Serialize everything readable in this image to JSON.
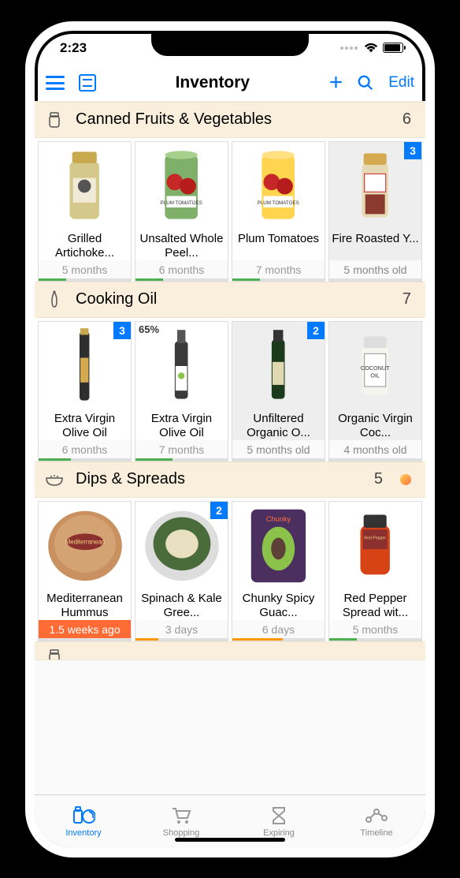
{
  "status": {
    "time": "2:23"
  },
  "nav": {
    "title": "Inventory",
    "edit": "Edit"
  },
  "sections": [
    {
      "icon": "jar",
      "title": "Canned Fruits & Vegetables",
      "count": "6",
      "dot": false,
      "items": [
        {
          "name": "Grilled Artichoke...",
          "age": "5 months",
          "badge": null,
          "pct": null,
          "aged": false,
          "progress": 30,
          "pcolor": "green",
          "img": "artichoke-jar"
        },
        {
          "name": "Unsalted Whole Peel...",
          "age": "6 months",
          "badge": null,
          "pct": null,
          "aged": false,
          "progress": 30,
          "pcolor": "green",
          "img": "plum-can-green"
        },
        {
          "name": "Plum Tomatoes",
          "age": "7 months",
          "badge": null,
          "pct": null,
          "aged": false,
          "progress": 30,
          "pcolor": "green",
          "img": "plum-can-yellow"
        },
        {
          "name": "Fire Roasted Y...",
          "age": "5 months old",
          "badge": "3",
          "pct": null,
          "aged": true,
          "progress": 0,
          "pcolor": "green",
          "img": "pepper-jar"
        }
      ]
    },
    {
      "icon": "oil",
      "title": "Cooking Oil",
      "count": "7",
      "dot": false,
      "items": [
        {
          "name": "Extra Virgin Olive Oil",
          "age": "6 months",
          "badge": "3",
          "pct": null,
          "aged": false,
          "progress": 35,
          "pcolor": "green",
          "img": "olive-tall-dark"
        },
        {
          "name": "Extra Virgin Olive Oil",
          "age": "7 months",
          "badge": null,
          "pct": "65%",
          "aged": false,
          "progress": 40,
          "pcolor": "green",
          "img": "olive-bottle-label"
        },
        {
          "name": "Unfiltered Organic O...",
          "age": "5 months old",
          "badge": "2",
          "pct": null,
          "aged": true,
          "progress": 0,
          "pcolor": "green",
          "img": "olive-dark-green"
        },
        {
          "name": "Organic Virgin Coc...",
          "age": "4 months old",
          "badge": null,
          "pct": null,
          "aged": true,
          "progress": 0,
          "pcolor": "green",
          "img": "coconut-jar"
        }
      ]
    },
    {
      "icon": "bowl",
      "title": "Dips & Spreads",
      "count": "5",
      "dot": true,
      "items": [
        {
          "name": "Mediterranean Hummus",
          "age": "1.5 weeks ago",
          "badge": null,
          "pct": null,
          "aged": false,
          "progress": 0,
          "pcolor": "green",
          "img": "hummus-tub",
          "age_red": true
        },
        {
          "name": "Spinach & Kale Gree...",
          "age": "3 days",
          "badge": "2",
          "pct": null,
          "aged": false,
          "progress": 25,
          "pcolor": "orange",
          "img": "spinach-dip"
        },
        {
          "name": "Chunky Spicy Guac...",
          "age": "6 days",
          "badge": null,
          "pct": null,
          "aged": false,
          "progress": 55,
          "pcolor": "orange",
          "img": "guac-box"
        },
        {
          "name": "Red Pepper Spread wit...",
          "age": "5 months",
          "badge": null,
          "pct": null,
          "aged": false,
          "progress": 30,
          "pcolor": "green",
          "img": "red-pepper-jar"
        }
      ]
    }
  ],
  "tabs": [
    {
      "label": "Inventory",
      "icon": "inventory",
      "active": true
    },
    {
      "label": "Shopping",
      "icon": "cart",
      "active": false
    },
    {
      "label": "Expiring",
      "icon": "hourglass",
      "active": false
    },
    {
      "label": "Timeline",
      "icon": "timeline",
      "active": false
    }
  ]
}
